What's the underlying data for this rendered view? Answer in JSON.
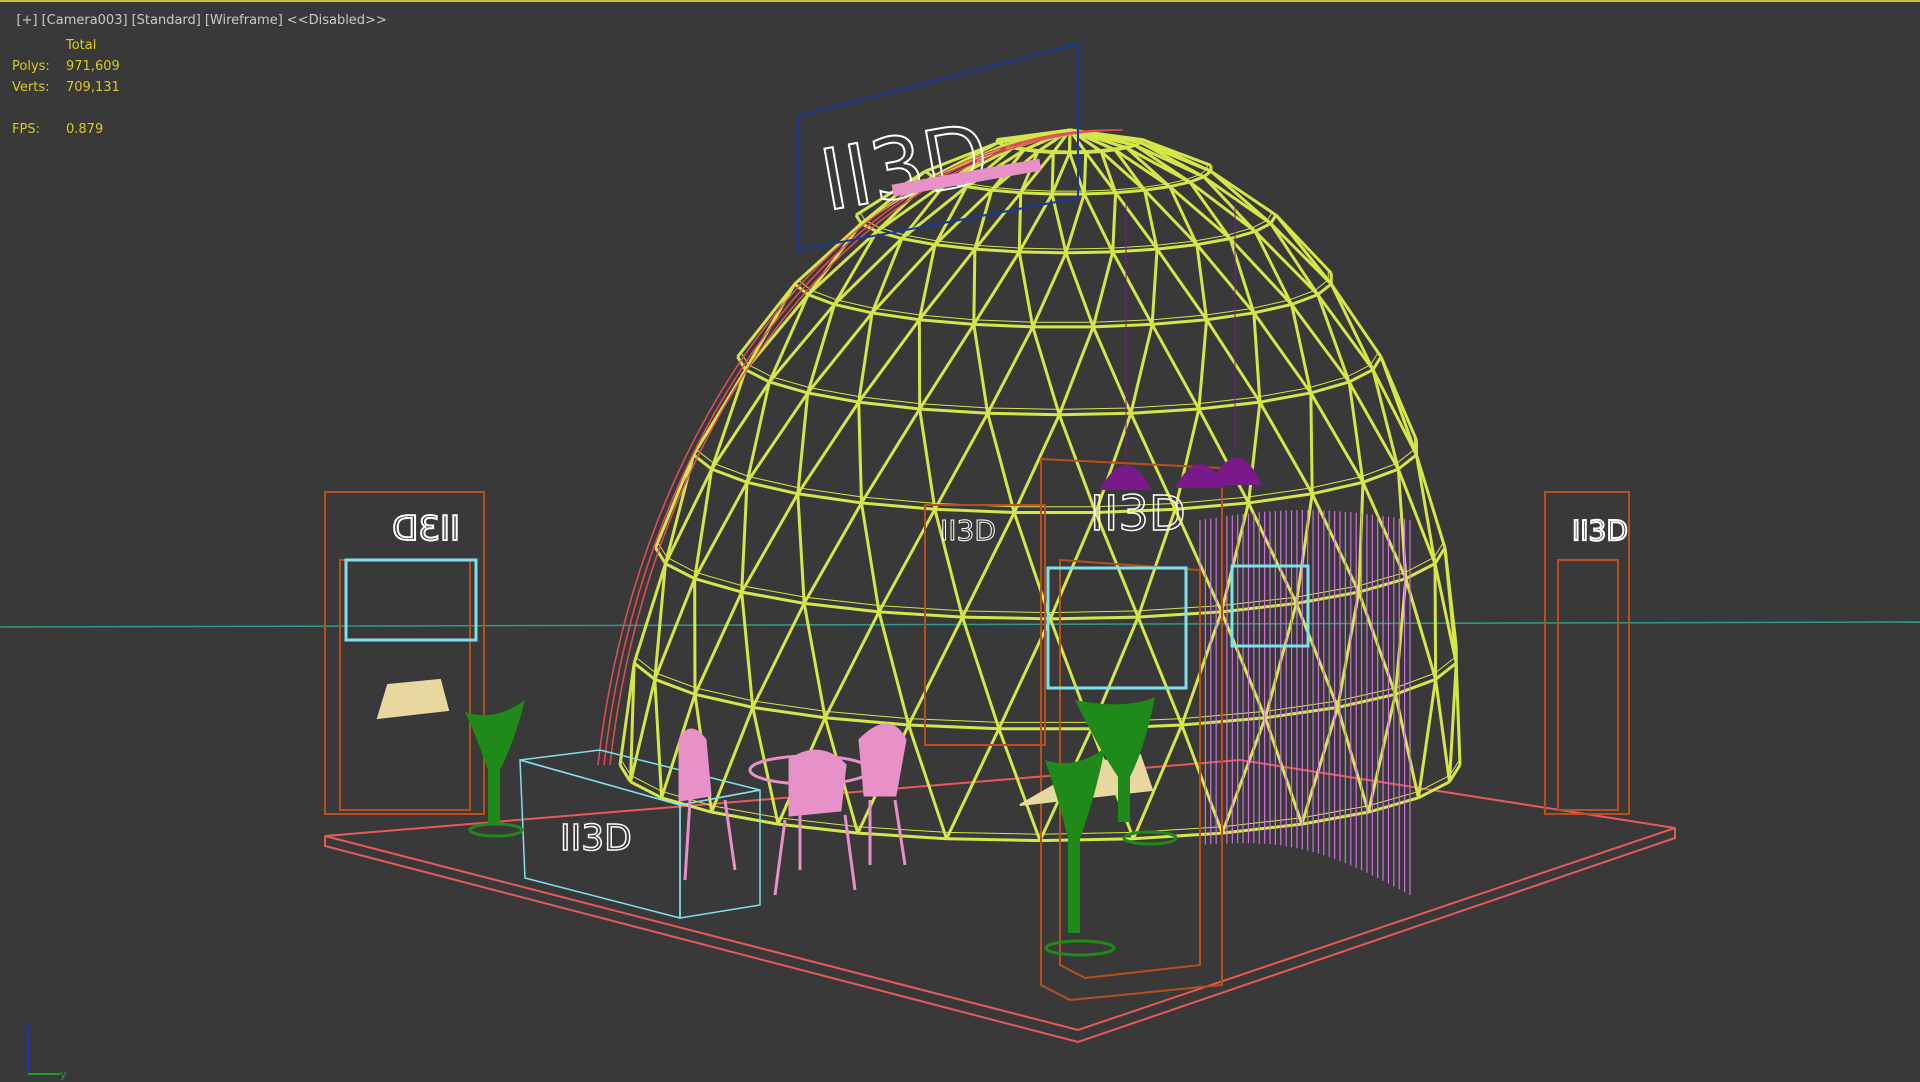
{
  "viewport": {
    "label_items": [
      "[+]",
      "[Camera003]",
      "[Standard]",
      "[Wireframe]",
      "<<Disabled>>"
    ],
    "stats": {
      "header": "Total",
      "polys_label": "Polys:",
      "polys_value": "971,609",
      "verts_label": "Verts:",
      "verts_value": "709,131",
      "fps_label": "FPS:",
      "fps_value": "0.879"
    },
    "axis": {
      "z": "z",
      "y": "y"
    },
    "logo_text": "II3D",
    "colors": {
      "background": "#393939",
      "dome": "#d4e64a",
      "dome_outer": "#e0505a",
      "floor": "#e85a5a",
      "panels": "#b8501e",
      "cyan": "#7fe0ee",
      "pink": "#e890c8",
      "magenta": "#d070e0",
      "green": "#1f8a1a",
      "purple": "#7a1a8a",
      "blue": "#1a3a9a"
    }
  }
}
